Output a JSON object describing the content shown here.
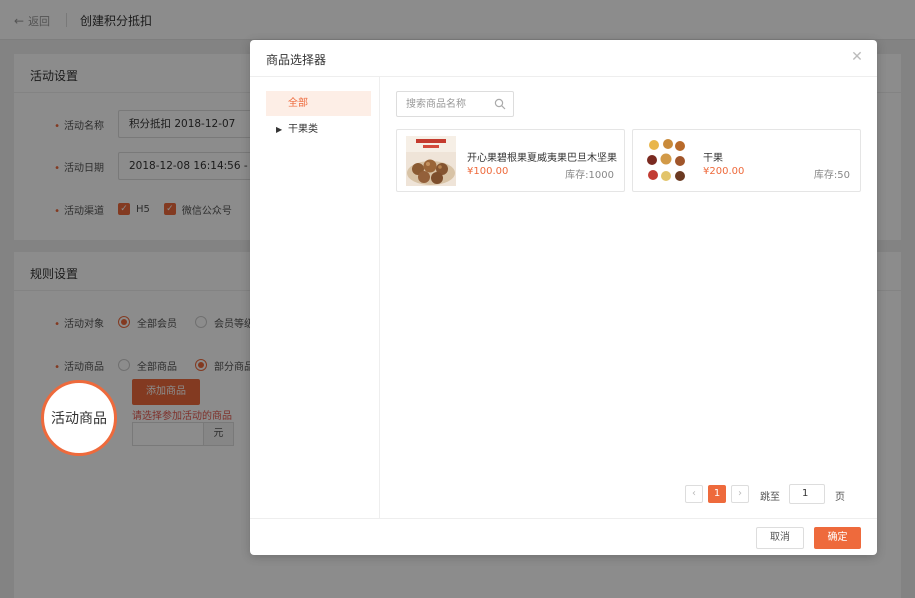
{
  "topbar": {
    "back_label": "返回",
    "title": "创建积分抵扣"
  },
  "activity_settings": {
    "section_title": "活动设置",
    "name_label": "活动名称",
    "name_value": "积分抵扣  2018-12-07",
    "date_label": "活动日期",
    "date_value": "2018-12-08 16:14:56  -  2",
    "channel_label": "活动渠道",
    "channels": [
      "H5",
      "微信公众号"
    ]
  },
  "rule_settings": {
    "section_title": "规则设置",
    "target_label": "活动对象",
    "target_options": [
      "全部会员",
      "会员等级"
    ],
    "goods_label": "活动商品",
    "goods_options": [
      "全部商品",
      "部分商品"
    ],
    "add_goods_button": "添加商品",
    "warning": "请选择参加活动的商品",
    "unit": "元"
  },
  "callout": {
    "text": "活动商品"
  },
  "modal": {
    "title": "商品选择器",
    "categories": [
      {
        "label": "全部",
        "active": true
      },
      {
        "label": "干果类",
        "active": false
      }
    ],
    "search_placeholder": "搜索商品名称",
    "products": [
      {
        "name": "开心果碧根果夏威夷果巴旦木坚果",
        "price": "¥100.00",
        "stock": "库存:1000"
      },
      {
        "name": "干果",
        "price": "¥200.00",
        "stock": "库存:50"
      }
    ],
    "pagination": {
      "current": "1",
      "jump_label": "跳至",
      "jump_value": "1",
      "page_suffix": "页"
    },
    "cancel_label": "取消",
    "confirm_label": "确定"
  },
  "colors": {
    "accent": "#ee6a3c",
    "overlay": "rgba(0,0,0,0.45)"
  }
}
